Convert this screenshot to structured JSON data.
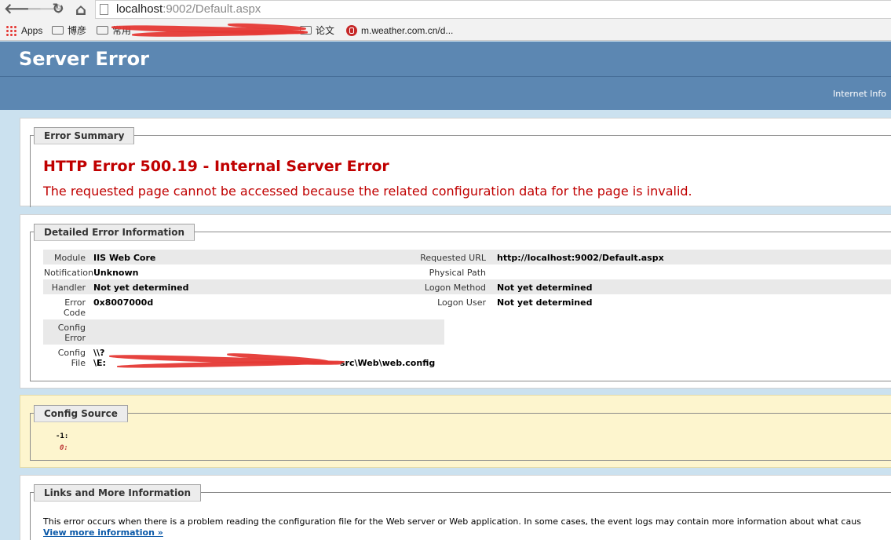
{
  "browser": {
    "back_glyph": "🡐",
    "forward_glyph": "🡒",
    "reload_glyph": "↻",
    "home_glyph": "⌂",
    "url_host": "localhost",
    "url_rest": ":9002/Default.aspx",
    "bookmarks": [
      {
        "label": "Apps",
        "icon": "apps-grid-icon"
      },
      {
        "label": "博彦",
        "icon": "folder-icon"
      },
      {
        "label": "常用",
        "icon": "folder-icon"
      },
      {
        "label": "论文",
        "icon": "folder-icon"
      },
      {
        "label": "m.weather.com.cn/d...",
        "icon": "weather-site-icon"
      }
    ]
  },
  "header": {
    "title": "Server Error",
    "subtitle": "Internet Info"
  },
  "summary": {
    "legend": "Error Summary",
    "heading": "HTTP Error 500.19 - Internal Server Error",
    "message": "The requested page cannot be accessed because the related configuration data for the page is invalid."
  },
  "detail": {
    "legend": "Detailed Error Information",
    "left": [
      {
        "label": "Module",
        "value": "IIS Web Core"
      },
      {
        "label": "Notification",
        "value": "Unknown"
      },
      {
        "label": "Handler",
        "value": "Not yet determined"
      },
      {
        "label": "Error Code",
        "value": "0x8007000d"
      },
      {
        "label": "Config Error",
        "value": ""
      },
      {
        "label": "Config File",
        "value_line1": "\\\\?",
        "value_line2": "\\E:",
        "value_line2_tail": "src\\Web\\web.config"
      }
    ],
    "right": [
      {
        "label": "Requested URL",
        "value": "http://localhost:9002/Default.aspx"
      },
      {
        "label": "Physical Path",
        "value": ""
      },
      {
        "label": "Logon Method",
        "value": "Not yet determined"
      },
      {
        "label": "Logon User",
        "value": "Not yet determined"
      }
    ]
  },
  "config_source": {
    "legend": "Config Source",
    "line1": "-1:",
    "line2": "0:"
  },
  "links": {
    "legend": "Links and More Information",
    "text": "This error occurs when there is a problem reading the configuration file for the Web server or Web application. In some cases, the event logs may contain more information about what caus",
    "more": "View more information »"
  },
  "colors": {
    "header_bg": "#5c87b2",
    "page_bg": "#cbe1ef",
    "error_red": "#c00000",
    "config_bg": "#fdf5ce",
    "link_blue": "#0b59a8",
    "redaction": "#e53935"
  }
}
